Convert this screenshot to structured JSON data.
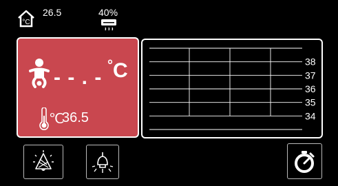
{
  "status": {
    "room_temp": "26.5",
    "humidity": "40%",
    "icons": {
      "room_temp": "house-celsius-icon",
      "humidifier": "humidifier-icon"
    }
  },
  "baby_panel": {
    "temp_value": "- - . -",
    "temp_unit": "C",
    "degree_symbol": "°",
    "skin_temp_unit": "℃",
    "skin_temp_value": "36.5",
    "bg_color": "#c9474f",
    "icons": {
      "baby": "baby-icon",
      "thermometer": "thermometer-icon"
    }
  },
  "chart_data": {
    "type": "line",
    "y_ticks": [
      "38",
      "37",
      "36",
      "35",
      "34"
    ],
    "grid": true,
    "series": []
  },
  "buttons": {
    "alarm": "alarm-bell-icon",
    "light": "light-bulb-icon",
    "timer": "timer-icon"
  }
}
